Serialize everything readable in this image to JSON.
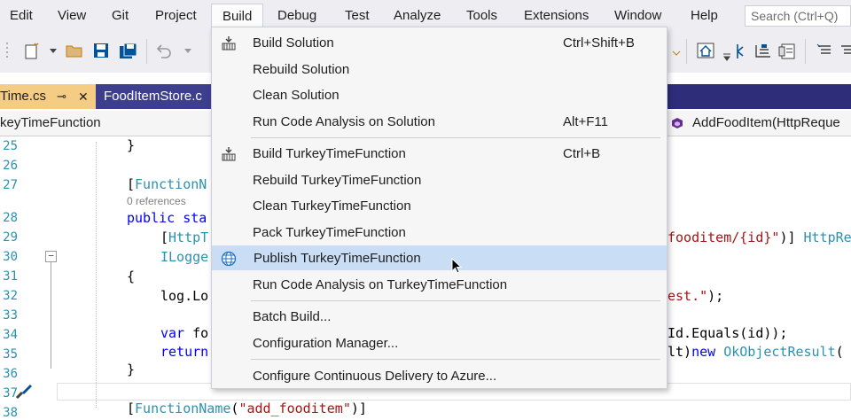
{
  "menubar": {
    "items": [
      "Edit",
      "View",
      "Git",
      "Project",
      "Build",
      "Debug",
      "Test",
      "Analyze",
      "Tools",
      "Extensions",
      "Window",
      "Help"
    ],
    "search_placeholder": "Search (Ctrl+Q)"
  },
  "tabs": {
    "active": "Time.cs",
    "active_pin": "⊸",
    "active_close": "✕",
    "inactive": "FoodItemStore.c"
  },
  "navbar": {
    "left": "keyTimeFunction",
    "right": "AddFoodItem(HttpReque"
  },
  "code": {
    "line_numbers": [
      "25",
      "26",
      "27",
      "28",
      "29",
      "30",
      "31",
      "32",
      "33",
      "34",
      "35",
      "36",
      "37",
      "38"
    ],
    "collapse_glyph": "−",
    "refs_label": "0 references",
    "l25": "}",
    "l27_punct": "[",
    "l27_type": "FunctionN",
    "l28_kw": "public sta",
    "l29_punct": "[",
    "l29_type": "HttpT",
    "l29_str": "fooditem/{id}\"",
    "l29_rest": ")] ",
    "l29_type2": "HttpReq",
    "l30_type": "ILogge",
    "l31": "{",
    "l32": "log.Lo",
    "l32_tail_str": "est.\"",
    "l32_tail": ");",
    "l34_kw": "var",
    "l34_rest": " fo",
    "l34_tail": "Id.Equals(id));",
    "l35_kw": "return",
    "l35_tail_a": "lt)",
    "l35_tail_kw": "new",
    "l35_tail_type": " OkObjectResult",
    "l35_tail_b": "(",
    "l36": "}",
    "l38_punct": "[",
    "l38_type": "FunctionName",
    "l38_open": "(",
    "l38_str": "\"add_fooditem\"",
    "l38_close": ")]"
  },
  "build_menu": {
    "groups": [
      [
        {
          "label": "Build Solution",
          "shortcut": "Ctrl+Shift+B",
          "icon": "build-icon"
        },
        {
          "label": "Rebuild Solution",
          "shortcut": ""
        },
        {
          "label": "Clean Solution",
          "shortcut": ""
        },
        {
          "label": "Run Code Analysis on Solution",
          "shortcut": "Alt+F11"
        }
      ],
      [
        {
          "label": "Build TurkeyTimeFunction",
          "shortcut": "Ctrl+B",
          "icon": "build-icon"
        },
        {
          "label": "Rebuild TurkeyTimeFunction",
          "shortcut": ""
        },
        {
          "label": "Clean TurkeyTimeFunction",
          "shortcut": ""
        },
        {
          "label": "Pack TurkeyTimeFunction",
          "shortcut": ""
        },
        {
          "label": "Publish TurkeyTimeFunction",
          "shortcut": "",
          "icon": "publish-globe-icon",
          "highlighted": true
        },
        {
          "label": "Run Code Analysis on TurkeyTimeFunction",
          "shortcut": ""
        }
      ],
      [
        {
          "label": "Batch Build...",
          "shortcut": ""
        },
        {
          "label": "Configuration Manager...",
          "shortcut": ""
        }
      ],
      [
        {
          "label": "Configure Continuous Delivery to Azure...",
          "shortcut": ""
        }
      ]
    ]
  },
  "colors": {
    "accent_tab": "#f5cc84",
    "tab_bar": "#2d2d7a",
    "highlight": "#c9def5",
    "keyword": "#0000ff",
    "type": "#2b91af",
    "string": "#a31515"
  }
}
